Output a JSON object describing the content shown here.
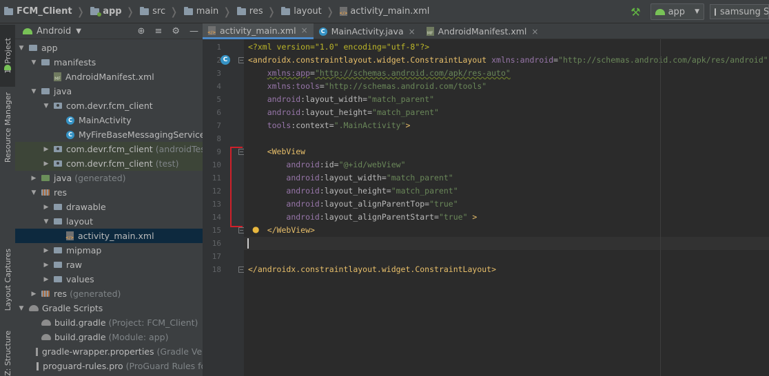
{
  "breadcrumbs": [
    {
      "label": "FCM_Client",
      "bold": true,
      "icon": "folder-icon"
    },
    {
      "label": "app",
      "bold": true,
      "icon": "module-folder-icon"
    },
    {
      "label": "src",
      "icon": "folder-icon"
    },
    {
      "label": "main",
      "icon": "folder-icon"
    },
    {
      "label": "res",
      "icon": "res-folder-icon"
    },
    {
      "label": "layout",
      "icon": "folder-icon"
    },
    {
      "label": "activity_main.xml",
      "icon": "xml-file-icon"
    }
  ],
  "toolbar": {
    "run_config": "app",
    "device": "samsung SM"
  },
  "left_strip": {
    "project": "1: Project",
    "resource_manager": "Resource Manager",
    "layout_captures": "Layout Captures",
    "structure": "Z: Structure"
  },
  "project_panel": {
    "view_mode": "Android"
  },
  "tree": [
    {
      "label": "app",
      "depth": 0,
      "icon": "module",
      "expanded": true
    },
    {
      "label": "manifests",
      "depth": 1,
      "icon": "folder",
      "expanded": true
    },
    {
      "label": "AndroidManifest.xml",
      "depth": 2,
      "icon": "manifest"
    },
    {
      "label": "java",
      "depth": 1,
      "icon": "folder",
      "expanded": true
    },
    {
      "label": "com.devr.fcm_client",
      "depth": 2,
      "icon": "package",
      "expanded": true
    },
    {
      "label": "MainActivity",
      "depth": 3,
      "icon": "class"
    },
    {
      "label": "MyFireBaseMessagingService",
      "depth": 3,
      "icon": "class"
    },
    {
      "label": "com.devr.fcm_client",
      "suffix": "(androidTest)",
      "depth": 2,
      "icon": "package",
      "expanded": false,
      "test": true
    },
    {
      "label": "com.devr.fcm_client",
      "suffix": "(test)",
      "depth": 2,
      "icon": "package",
      "expanded": false,
      "test": true
    },
    {
      "label": "java",
      "suffix": "(generated)",
      "depth": 1,
      "icon": "folder-green",
      "expanded": false
    },
    {
      "label": "res",
      "depth": 1,
      "icon": "res",
      "expanded": true
    },
    {
      "label": "drawable",
      "depth": 2,
      "icon": "folder",
      "expanded": false
    },
    {
      "label": "layout",
      "depth": 2,
      "icon": "folder",
      "expanded": true
    },
    {
      "label": "activity_main.xml",
      "depth": 3,
      "icon": "xml",
      "selected": true
    },
    {
      "label": "mipmap",
      "depth": 2,
      "icon": "folder",
      "expanded": false
    },
    {
      "label": "raw",
      "depth": 2,
      "icon": "folder",
      "expanded": false
    },
    {
      "label": "values",
      "depth": 2,
      "icon": "folder",
      "expanded": false
    },
    {
      "label": "res",
      "suffix": "(generated)",
      "depth": 1,
      "icon": "res",
      "expanded": false
    },
    {
      "label": "Gradle Scripts",
      "depth": 0,
      "icon": "gradle",
      "expanded": true
    },
    {
      "label": "build.gradle",
      "suffix": "(Project: FCM_Client)",
      "depth": 1,
      "icon": "gradle"
    },
    {
      "label": "build.gradle",
      "suffix": "(Module: app)",
      "depth": 1,
      "icon": "gradle"
    },
    {
      "label": "gradle-wrapper.properties",
      "suffix": "(Gradle Versio",
      "depth": 1,
      "icon": "wrapper"
    },
    {
      "label": "proguard-rules.pro",
      "suffix": "(ProGuard Rules for a",
      "depth": 1,
      "icon": "pro"
    }
  ],
  "editor_tabs": [
    {
      "label": "activity_main.xml",
      "icon": "xml-file-icon",
      "active": true
    },
    {
      "label": "MainActivity.java",
      "icon": "class-icon",
      "active": false
    },
    {
      "label": "AndroidManifest.xml",
      "icon": "manifest-icon",
      "active": false
    }
  ],
  "code_lines": [
    {
      "n": "1",
      "tokens": [
        [
          "pi",
          "<?xml version=\"1.0\" encoding=\"utf-8\"?>"
        ]
      ]
    },
    {
      "n": "2",
      "tokens": [
        [
          "tag",
          "<androidx.constraintlayout.widget.ConstraintLayout "
        ],
        [
          "ns",
          "xmlns:android"
        ],
        [
          "attr",
          "="
        ],
        [
          "val",
          "\"http://schemas.android.com/apk/res/android\""
        ]
      ]
    },
    {
      "n": "3",
      "indent": "    ",
      "tokens": [
        [
          "nssq",
          "xmlns:app"
        ],
        [
          "attr",
          "="
        ],
        [
          "valsq",
          "\"http://schemas.android.com/apk/res-auto\""
        ]
      ]
    },
    {
      "n": "4",
      "indent": "    ",
      "tokens": [
        [
          "ns",
          "xmlns:tools"
        ],
        [
          "attr",
          "="
        ],
        [
          "val",
          "\"http://schemas.android.com/tools\""
        ]
      ]
    },
    {
      "n": "5",
      "indent": "    ",
      "tokens": [
        [
          "ns",
          "android"
        ],
        [
          "attr",
          ":layout_width="
        ],
        [
          "val",
          "\"match_parent\""
        ]
      ]
    },
    {
      "n": "6",
      "indent": "    ",
      "tokens": [
        [
          "ns",
          "android"
        ],
        [
          "attr",
          ":layout_height="
        ],
        [
          "val",
          "\"match_parent\""
        ]
      ]
    },
    {
      "n": "7",
      "indent": "    ",
      "tokens": [
        [
          "ns",
          "tools"
        ],
        [
          "attr",
          ":context="
        ],
        [
          "val",
          "\".MainActivity\""
        ],
        [
          "tag",
          ">"
        ]
      ]
    },
    {
      "n": "8",
      "tokens": []
    },
    {
      "n": "9",
      "indent": "    ",
      "tokens": [
        [
          "tag",
          "<WebView"
        ]
      ]
    },
    {
      "n": "10",
      "indent": "        ",
      "tokens": [
        [
          "ns",
          "android"
        ],
        [
          "attr",
          ":id="
        ],
        [
          "val",
          "\"@+id/webView\""
        ]
      ]
    },
    {
      "n": "11",
      "indent": "        ",
      "tokens": [
        [
          "ns",
          "android"
        ],
        [
          "attr",
          ":layout_width="
        ],
        [
          "val",
          "\"match_parent\""
        ]
      ]
    },
    {
      "n": "12",
      "indent": "        ",
      "tokens": [
        [
          "ns",
          "android"
        ],
        [
          "attr",
          ":layout_height="
        ],
        [
          "val",
          "\"match_parent\""
        ]
      ]
    },
    {
      "n": "13",
      "indent": "        ",
      "tokens": [
        [
          "ns",
          "android"
        ],
        [
          "attr",
          ":layout_alignParentTop="
        ],
        [
          "val",
          "\"true\""
        ]
      ]
    },
    {
      "n": "14",
      "indent": "        ",
      "tokens": [
        [
          "ns",
          "android"
        ],
        [
          "attr",
          ":layout_alignParentStart="
        ],
        [
          "val",
          "\"true\""
        ],
        [
          "tag",
          " >"
        ]
      ]
    },
    {
      "n": "15",
      "indent": "    ",
      "tokens": [
        [
          "tag",
          "</WebView>"
        ]
      ]
    },
    {
      "n": "16",
      "tokens": []
    },
    {
      "n": "17",
      "tokens": []
    },
    {
      "n": "18",
      "tokens": [
        [
          "tag",
          "</androidx.constraintlayout.widget.ConstraintLayout>"
        ]
      ]
    }
  ],
  "colors": {
    "accent": "#4a88c7",
    "highlight_box": "#d0202a",
    "tag": "#e8bf6a",
    "namespace": "#9876aa",
    "value": "#6a8759"
  }
}
